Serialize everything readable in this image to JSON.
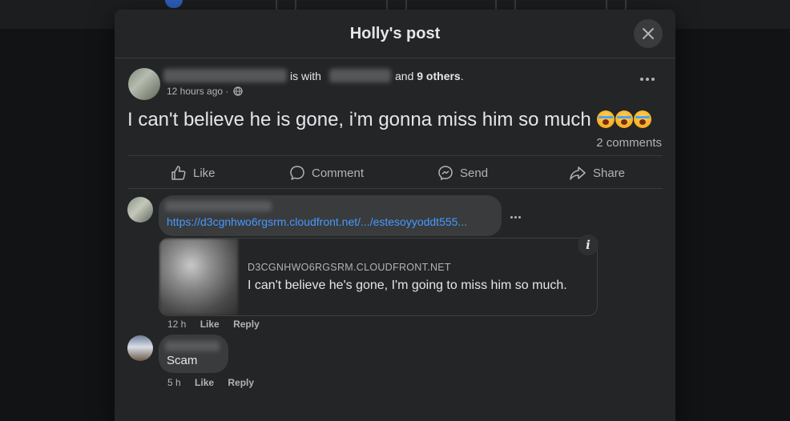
{
  "modal": {
    "title": "Holly's post"
  },
  "post": {
    "with_text": "is with",
    "and_text": "and",
    "others_text": "9 others",
    "period": ".",
    "time": "12 hours ago",
    "separator": "·",
    "text": "I can't believe he is gone, i'm gonna miss him so much",
    "comments_count": "2 comments"
  },
  "actions": {
    "like": "Like",
    "comment": "Comment",
    "send": "Send",
    "share": "Share"
  },
  "comments": [
    {
      "link": "https://d3cgnhwo6rgsrm.cloudfront.net/.../estesoyyoddt555...",
      "preview": {
        "domain": "D3CGNHWO6RGSRM.CLOUDFRONT.NET",
        "title": "I can't believe he's gone, I'm going to miss him so much."
      },
      "time": "12 h",
      "like": "Like",
      "reply": "Reply"
    },
    {
      "text": "Scam",
      "time": "5 h",
      "like": "Like",
      "reply": "Reply"
    }
  ],
  "icons": {
    "close": "close-icon",
    "globe": "globe-icon",
    "more": "more-options-icon",
    "like": "thumbs-up-icon",
    "comment": "comment-bubble-icon",
    "send": "messenger-icon",
    "share": "share-arrow-icon",
    "info": "info-icon",
    "emoji": "loudly-crying-face-icon"
  }
}
